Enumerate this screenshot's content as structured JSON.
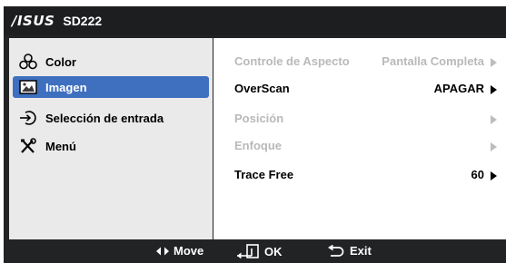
{
  "header": {
    "brand": "/ISUS",
    "model": "SD222"
  },
  "menu": {
    "items": [
      {
        "label": "Color",
        "icon": "color-icon",
        "selected": false
      },
      {
        "label": "Imagen",
        "icon": "image-icon",
        "selected": true
      },
      {
        "label": "Selección de entrada",
        "icon": "input-source-icon",
        "selected": false
      },
      {
        "label": "Menú",
        "icon": "tools-icon",
        "selected": false
      }
    ]
  },
  "settings": {
    "rows": [
      {
        "label": "Controle de Aspecto",
        "value": "Pantalla Completa",
        "enabled": false
      },
      {
        "label": "OverScan",
        "value": "APAGAR",
        "enabled": true
      },
      {
        "label": "Posición",
        "value": "",
        "enabled": false
      },
      {
        "label": "Enfoque",
        "value": "",
        "enabled": false
      },
      {
        "label": "Trace Free",
        "value": "60",
        "enabled": true
      }
    ]
  },
  "footer": {
    "move": "Move",
    "ok": "OK",
    "exit": "Exit"
  },
  "colors": {
    "selected": "#3f6fbf",
    "panel": "#eaeaea",
    "background": "#222325",
    "disabled_text": "#b9b9b9"
  }
}
